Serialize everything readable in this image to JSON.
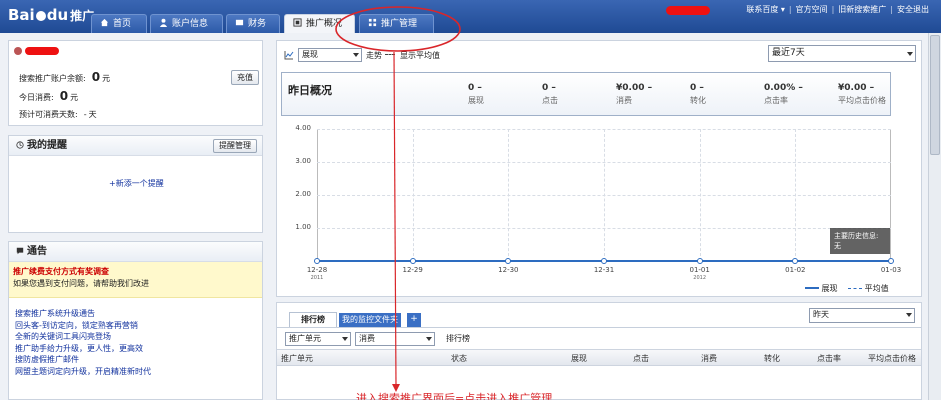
{
  "header": {
    "logo_text": "Bai",
    "logo_text2": "du",
    "logo_sub": "推广",
    "tabs": [
      {
        "label": "首页"
      },
      {
        "label": "账户信息"
      },
      {
        "label": "财务"
      },
      {
        "label": "推广概况"
      },
      {
        "label": "推广管理"
      }
    ],
    "links": [
      "联系百度 ▾",
      "官方空间",
      "旧新搜索推广",
      "安全退出"
    ]
  },
  "account": {
    "balance_label": "搜索推广账户余额:",
    "balance_value": "0",
    "balance_unit": "元",
    "topup_label": "充值",
    "today_label": "今日消费:",
    "today_value": "0",
    "today_unit": "元",
    "days_label": "预计可消费天数:",
    "days_value": "-",
    "days_unit": "天"
  },
  "reminders": {
    "title": "我的提醒",
    "manage_label": "提醒管理",
    "add_label": "+新添一个提醒"
  },
  "notice": {
    "title": "通告",
    "highlight_title": "推广续费支付方式有奖调查",
    "highlight_text": "如果您遇到支付问题，请帮助我们改进",
    "items": [
      "搜索推广系统升级通告",
      "回头客-到访定向，锁定熟客再营销",
      "全新的关键词工具闪亮登场",
      "推广助手给力升级，更人性，更高效",
      "搜防虚假推广邮件",
      "网盟主题词定向升级，开启精准新时代"
    ]
  },
  "trend": {
    "metric_select": "展现",
    "trend_label": "走势",
    "avg_label": "显示平均值",
    "range_select": "最近7天",
    "yesterday_title": "昨日概况",
    "stats": [
      {
        "value": "0",
        "label": "展现"
      },
      {
        "value": "0",
        "label": "点击"
      },
      {
        "value": "¥0.00",
        "label": "消费"
      },
      {
        "value": "0",
        "label": "转化"
      },
      {
        "value": "0.00%",
        "label": "点击率"
      },
      {
        "value": "¥0.00",
        "label": "平均点击价格"
      }
    ],
    "tooltip_line1": "主要历史信息:",
    "tooltip_line2": "无",
    "legend_series": "展现",
    "legend_avg": "平均值"
  },
  "chart_data": {
    "type": "line",
    "x": [
      "12-28",
      "12-29",
      "12-30",
      "12-31",
      "01-01",
      "01-02",
      "01-03"
    ],
    "x_year_marks": [
      "2011",
      "",
      "",
      "",
      "2012",
      "",
      ""
    ],
    "series": [
      {
        "name": "展现",
        "values": [
          0,
          0,
          0,
          0,
          0,
          0,
          0
        ]
      }
    ],
    "yticks": [
      "4.00",
      "3.00",
      "2.00",
      "1.00"
    ],
    "ylim": [
      0,
      4
    ],
    "grid": true,
    "legend_position": "bottom-right"
  },
  "ranking": {
    "tabs": [
      "排行榜",
      "我的监控文件夹",
      "+"
    ],
    "period_select": "昨天",
    "unit_select": "推广单元",
    "metric_select": "消费",
    "rank_label": "排行榜",
    "columns": [
      "推广单元",
      "状态",
      "展现",
      "点击",
      "消费",
      "转化",
      "点击率",
      "平均点击价格"
    ]
  },
  "annotation": {
    "text": "进入搜索推广界面后=点击进入推广管理"
  }
}
